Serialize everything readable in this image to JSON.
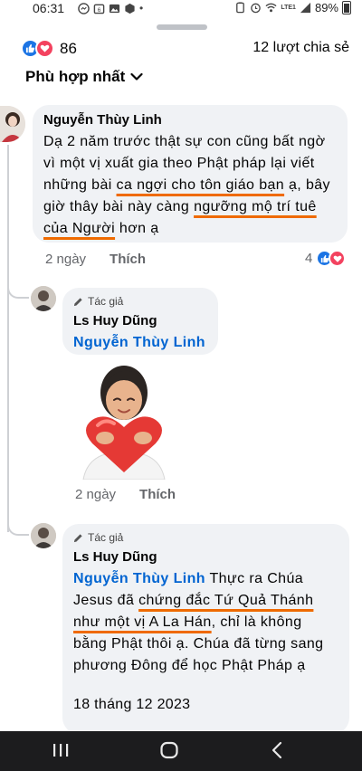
{
  "status_bar": {
    "time": "06:31",
    "network": "LTE1",
    "battery": "89%"
  },
  "header": {
    "reaction_count": "86",
    "share_count": "12 lượt chia sẻ",
    "sort_label": "Phù hợp nhất"
  },
  "comments": [
    {
      "author": "Nguyễn Thùy Linh",
      "text_parts": [
        {
          "text": "Dạ 2 năm trước thật sự con cũng bất ngờ vì một vị xuất gia theo Phật pháp lại viết những bài ",
          "u": false
        },
        {
          "text": "ca ngợi cho tôn giáo bạn",
          "u": true
        },
        {
          "text": " ạ, bây giờ thây bài này càng ",
          "u": false
        },
        {
          "text": "ngưỡng mộ trí tuê của Người",
          "u": true
        },
        {
          "text": " hơn ạ",
          "u": false
        }
      ],
      "time": "2 ngày",
      "like_label": "Thích",
      "reaction_count": "4"
    },
    {
      "author_tag": "Tác giả",
      "author": "Ls Huy Dũng",
      "mention": "Nguyễn Thùy Linh",
      "time": "2 ngày",
      "like_label": "Thích"
    },
    {
      "author_tag": "Tác giả",
      "author": "Ls Huy Dũng",
      "mention": "Nguyễn Thùy Linh",
      "text_parts": [
        {
          "text": " Thực ra Chúa Jesus đã ",
          "u": false
        },
        {
          "text": "chứng đắc Tứ Quả Thánh như một vị A La Hán",
          "u": true
        },
        {
          "text": ", chỉ là không bằng Phật thôi ạ. Chúa đã từng sang phương Đông để học Phật Pháp ạ",
          "u": false
        }
      ],
      "date": "18 tháng 12 2023"
    }
  ],
  "colors": {
    "like_blue": "#1b74e4",
    "love_red": "#f3425f",
    "mention_blue": "#0064d1",
    "underline_orange": "#ef6a00",
    "bubble_gray": "#f0f2f5"
  }
}
